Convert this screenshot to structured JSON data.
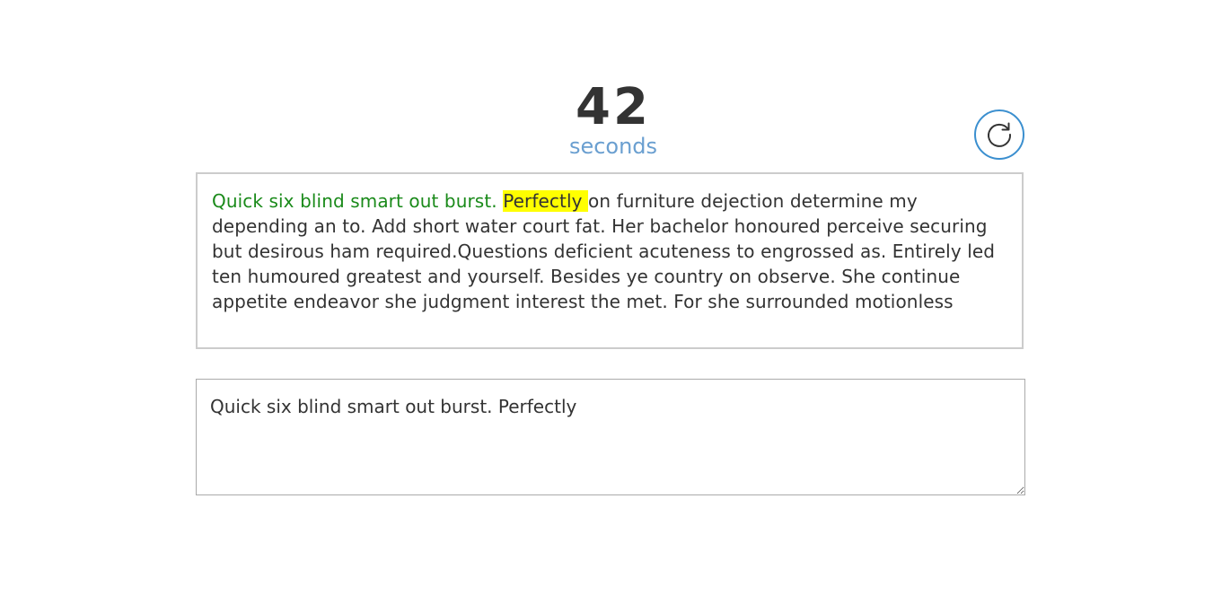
{
  "timer": {
    "value": "42",
    "unit": "seconds"
  },
  "reset_button": {
    "icon": "refresh-icon",
    "color": "#3b8fcf"
  },
  "passage": {
    "typed_text": "Quick six blind smart out burst. ",
    "current_word": "Perfectly ",
    "remaining_text": "on furniture dejection determine my depending an to. Add short water court fat. Her bachelor honoured perceive securing but desirous ham required.Questions deficient acuteness to engrossed as. Entirely led ten humoured greatest and yourself. Besides ye country on observe. She continue appetite endeavor she judgment interest the met. For she surrounded motionless",
    "typed_color": "#1a8a1a",
    "highlight_color": "#ffff00"
  },
  "input": {
    "value": "Quick six blind smart out burst. Perfectly"
  }
}
